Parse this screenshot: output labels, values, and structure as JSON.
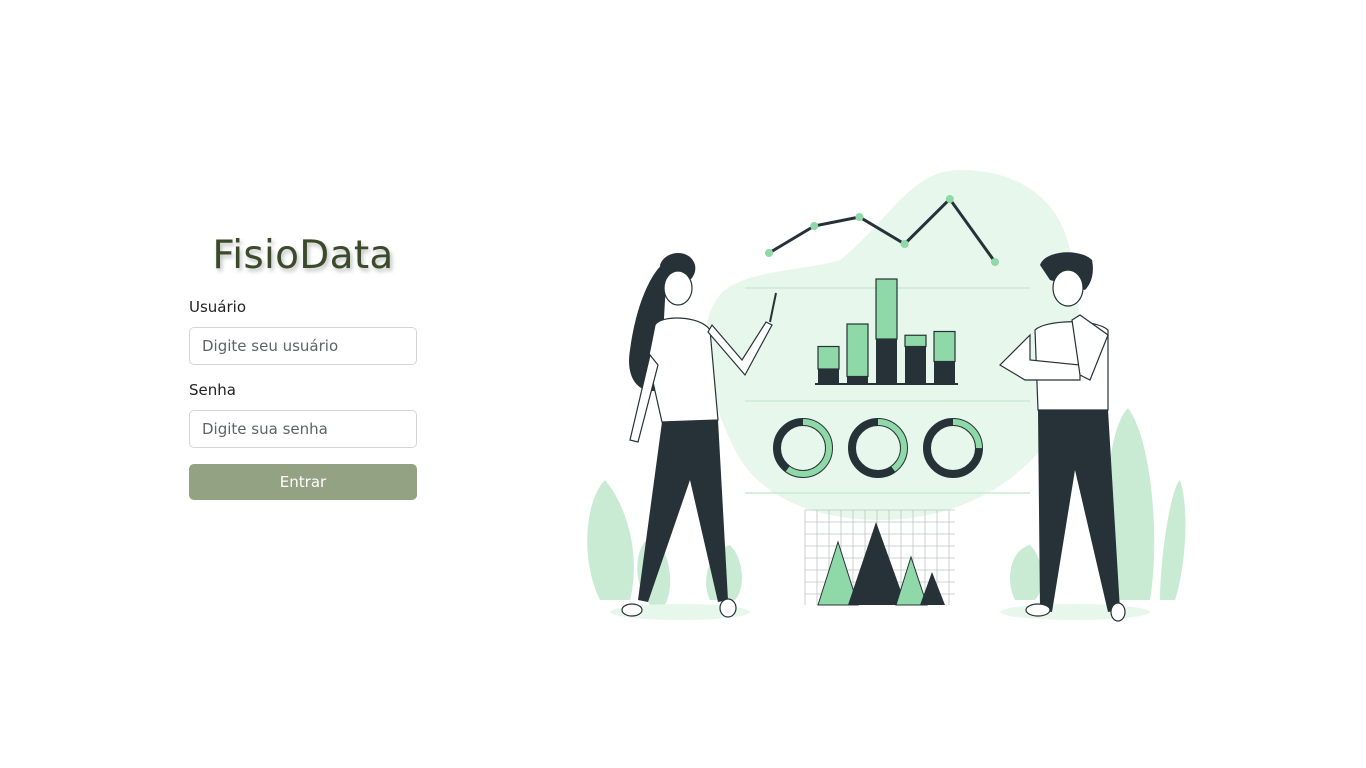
{
  "brand": {
    "title": "FisioData"
  },
  "form": {
    "username": {
      "label": "Usuário",
      "placeholder": "Digite seu usuário",
      "value": ""
    },
    "password": {
      "label": "Senha",
      "placeholder": "Digite sua senha",
      "value": ""
    },
    "submit_label": "Entrar"
  },
  "illustration": {
    "subject": "two people presenting charts",
    "accent_color": "#8fd9a8",
    "light_accent_color": "#e8f7ec",
    "dark_color": "#263238",
    "bar_values": [
      {
        "dark": 2,
        "light": 3
      },
      {
        "dark": 1,
        "light": 7
      },
      {
        "dark": 6,
        "light": 8
      },
      {
        "dark": 5,
        "light": 1.5
      },
      {
        "dark": 3,
        "light": 4
      }
    ],
    "line_points": [
      1,
      4,
      5,
      2,
      7,
      0
    ],
    "donut_fractions": [
      0.6,
      0.4,
      0.25
    ]
  },
  "colors": {
    "button": "#93a283",
    "brand_text": "#3b4a2a"
  }
}
